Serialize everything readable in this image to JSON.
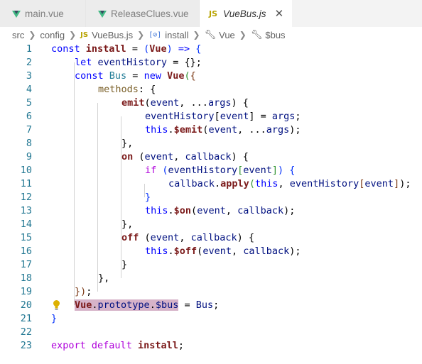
{
  "tabs": [
    {
      "label": "main.vue",
      "icon": "vue-icon",
      "active": false
    },
    {
      "label": "ReleaseClues.vue",
      "icon": "vue-icon",
      "active": false
    },
    {
      "label": "VueBus.js",
      "icon": "js-icon",
      "active": true,
      "close": "✕"
    }
  ],
  "breadcrumb": {
    "items": [
      "src",
      "config",
      "VueBus.js",
      "install",
      "Vue",
      "$bus"
    ],
    "js_badge": "JS",
    "var_badge": "[⊘]"
  },
  "code_lines": [
    {
      "n": "1"
    },
    {
      "n": "2"
    },
    {
      "n": "3"
    },
    {
      "n": "4"
    },
    {
      "n": "5"
    },
    {
      "n": "6"
    },
    {
      "n": "7"
    },
    {
      "n": "8"
    },
    {
      "n": "9"
    },
    {
      "n": "10"
    },
    {
      "n": "11"
    },
    {
      "n": "12"
    },
    {
      "n": "13"
    },
    {
      "n": "14"
    },
    {
      "n": "15"
    },
    {
      "n": "16"
    },
    {
      "n": "17"
    },
    {
      "n": "18"
    },
    {
      "n": "19"
    },
    {
      "n": "20"
    },
    {
      "n": "21"
    },
    {
      "n": "22"
    },
    {
      "n": "23"
    }
  ],
  "code": {
    "l1": [
      "const",
      "install",
      "=",
      "(",
      "Vue",
      ")",
      "=>",
      "{"
    ],
    "l2": [
      "let",
      "eventHistory",
      "= {};"
    ],
    "l3": [
      "const",
      "Bus",
      "=",
      "new",
      "Vue",
      "(",
      "{"
    ],
    "l4": [
      "methods",
      ": {"
    ],
    "l5": [
      "emit",
      "(",
      "event",
      ", ...",
      "args",
      ")",
      "{"
    ],
    "l6": [
      "eventHistory",
      "[",
      "event",
      "] = ",
      "args",
      ";"
    ],
    "l7": [
      "this",
      ".",
      "$emit",
      "(",
      "event",
      ", ...",
      "args",
      ");"
    ],
    "l8": [
      "},"
    ],
    "l9": [
      "on",
      "(",
      "event",
      ", ",
      "callback",
      ")",
      "{"
    ],
    "l10": [
      "if",
      "(",
      "eventHistory",
      "[",
      "event",
      "]",
      ")",
      "{"
    ],
    "l11": [
      "callback",
      ".",
      "apply",
      "(",
      "this",
      ", ",
      "eventHistory",
      "[",
      "event",
      "]",
      ");"
    ],
    "l12": [
      "}"
    ],
    "l13": [
      "this",
      ".",
      "$on",
      "(",
      "event",
      ", ",
      "callback",
      ");"
    ],
    "l14": [
      "},"
    ],
    "l15": [
      "off",
      "(",
      "event",
      ", ",
      "callback",
      ")",
      "{"
    ],
    "l16": [
      "this",
      ".",
      "$off",
      "(",
      "event",
      ", ",
      "callback",
      ");"
    ],
    "l17": [
      "}"
    ],
    "l18": [
      "},"
    ],
    "l19": [
      "})",
      ";"
    ],
    "l20": [
      "Vue",
      ".",
      "prototype",
      ".",
      "$bus",
      " = ",
      "Bus",
      ";"
    ],
    "l21": [
      "}"
    ],
    "l22": [],
    "l23": [
      "export",
      "default",
      "install",
      ";"
    ]
  },
  "colors": {
    "keyword": "#0000ff",
    "identifier": "#001080",
    "line_number": "#237893",
    "highlight": "#d6b3c9",
    "bracket1": "#0431fa",
    "bracket2": "#319331",
    "bracket3": "#7b3814"
  }
}
